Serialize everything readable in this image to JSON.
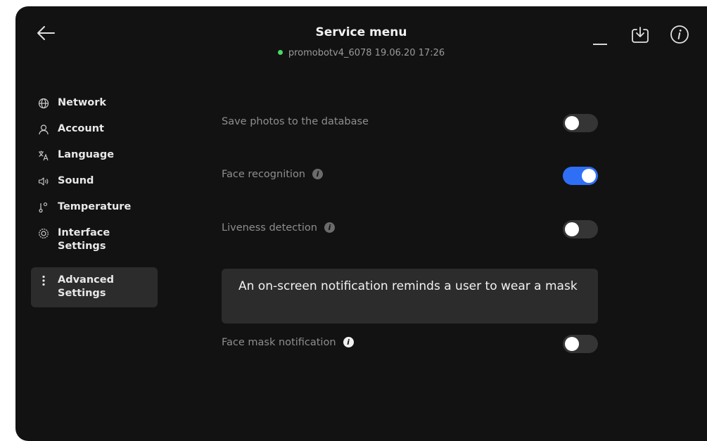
{
  "header": {
    "title": "Service menu",
    "status_text": "promobotv4_6078 19.06.20  17:26",
    "status_color": "#4cd964"
  },
  "icons": {
    "back": "arrow-left-icon",
    "minimize": "minimize-icon",
    "download": "download-icon",
    "info": "info-icon"
  },
  "sidebar": {
    "items": [
      {
        "label": "Network",
        "icon": "globe-icon"
      },
      {
        "label": "Account",
        "icon": "user-icon"
      },
      {
        "label": "Language",
        "icon": "translate-icon"
      },
      {
        "label": "Sound",
        "icon": "speaker-icon"
      },
      {
        "label": "Temperature",
        "icon": "thermometer-icon"
      },
      {
        "label": "Interface Settings",
        "icon": "gear-icon"
      },
      {
        "label": "Advanced Settings",
        "icon": "vertical-dots-icon",
        "active": true
      }
    ]
  },
  "settings": [
    {
      "label": "Save photos to the database",
      "info": false,
      "enabled": false
    },
    {
      "label": "Face recognition",
      "info": true,
      "enabled": true
    },
    {
      "label": "Liveness detection",
      "info": true,
      "enabled": false
    },
    {
      "label": "Face mask notification",
      "info": true,
      "enabled": false
    }
  ],
  "tooltip": {
    "text": "An on-screen notification reminds a user to wear a mask"
  },
  "colors": {
    "background": "#121212",
    "accent": "#2f6ff6",
    "active_item": "#2c2c2c"
  }
}
